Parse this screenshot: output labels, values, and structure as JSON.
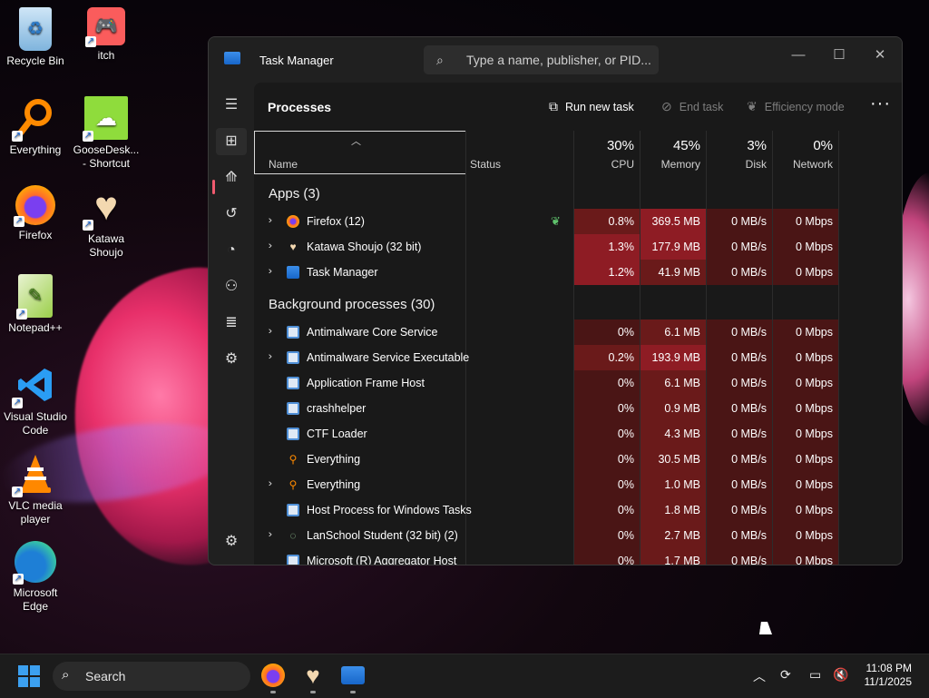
{
  "desktop": {
    "icons": [
      {
        "label": "Recycle Bin",
        "icon": "recycle-bin-icon"
      },
      {
        "label": "itch",
        "icon": "itch-icon"
      },
      {
        "label": "Everything",
        "icon": "everything-icon"
      },
      {
        "label": "GooseDesk... - Shortcut",
        "icon": "goose-icon"
      },
      {
        "label": "Firefox",
        "icon": "firefox-icon"
      },
      {
        "label": "Katawa Shoujo",
        "icon": "katawa-icon"
      },
      {
        "label": "Notepad++",
        "icon": "notepadpp-icon"
      },
      {
        "label": "Visual Studio Code",
        "icon": "vscode-icon"
      },
      {
        "label": "VLC media player",
        "icon": "vlc-icon"
      },
      {
        "label": "Microsoft Edge",
        "icon": "edge-icon"
      }
    ]
  },
  "window": {
    "title": "Task Manager",
    "search_placeholder": "Type a name, publisher, or PID...",
    "page_title": "Processes",
    "toolbar": {
      "run_new_task": "Run new task",
      "end_task": "End task",
      "efficiency_mode": "Efficiency mode"
    },
    "columns": {
      "name": "Name",
      "status": "Status",
      "cpu_pct": "30%",
      "cpu": "CPU",
      "memory_pct": "45%",
      "memory": "Memory",
      "disk_pct": "3%",
      "disk": "Disk",
      "network_pct": "0%",
      "network": "Network"
    },
    "apps_title": "Apps (3)",
    "apps": [
      {
        "name": "Firefox (12)",
        "cpu": "0.8%",
        "memory": "369.5 MB",
        "disk": "0 MB/s",
        "network": "0 Mbps",
        "expand": true,
        "efficiency": true
      },
      {
        "name": "Katawa Shoujo (32 bit)",
        "cpu": "1.3%",
        "memory": "177.9 MB",
        "disk": "0 MB/s",
        "network": "0 Mbps",
        "expand": true
      },
      {
        "name": "Task Manager",
        "cpu": "1.2%",
        "memory": "41.9 MB",
        "disk": "0 MB/s",
        "network": "0 Mbps",
        "expand": true
      }
    ],
    "bg_title": "Background processes (30)",
    "background": [
      {
        "name": "Antimalware Core Service",
        "cpu": "0%",
        "memory": "6.1 MB",
        "disk": "0 MB/s",
        "network": "0 Mbps",
        "expand": true
      },
      {
        "name": "Antimalware Service Executable",
        "cpu": "0.2%",
        "memory": "193.9 MB",
        "disk": "0 MB/s",
        "network": "0 Mbps",
        "expand": true
      },
      {
        "name": "Application Frame Host",
        "cpu": "0%",
        "memory": "6.1 MB",
        "disk": "0 MB/s",
        "network": "0 Mbps",
        "expand": false
      },
      {
        "name": "crashhelper",
        "cpu": "0%",
        "memory": "0.9 MB",
        "disk": "0 MB/s",
        "network": "0 Mbps",
        "expand": false
      },
      {
        "name": "CTF Loader",
        "cpu": "0%",
        "memory": "4.3 MB",
        "disk": "0 MB/s",
        "network": "0 Mbps",
        "expand": false
      },
      {
        "name": "Everything",
        "cpu": "0%",
        "memory": "30.5 MB",
        "disk": "0 MB/s",
        "network": "0 Mbps",
        "expand": false
      },
      {
        "name": "Everything",
        "cpu": "0%",
        "memory": "1.0 MB",
        "disk": "0 MB/s",
        "network": "0 Mbps",
        "expand": true
      },
      {
        "name": "Host Process for Windows Tasks",
        "cpu": "0%",
        "memory": "1.8 MB",
        "disk": "0 MB/s",
        "network": "0 Mbps",
        "expand": false
      },
      {
        "name": "LanSchool Student (32 bit) (2)",
        "cpu": "0%",
        "memory": "2.7 MB",
        "disk": "0 MB/s",
        "network": "0 Mbps",
        "expand": true
      },
      {
        "name": "Microsoft (R) Aggregator Host",
        "cpu": "0%",
        "memory": "1.7 MB",
        "disk": "0 MB/s",
        "network": "0 Mbps",
        "expand": false
      }
    ]
  },
  "taskbar": {
    "search_label": "Search",
    "time": "11:08 PM",
    "date": "11/1/2025"
  },
  "colors": {
    "heat_low": "#4a1515",
    "heat_mid": "#6a1a1a",
    "heat_high": "#8e1c24",
    "accent": "#f05a6e"
  }
}
